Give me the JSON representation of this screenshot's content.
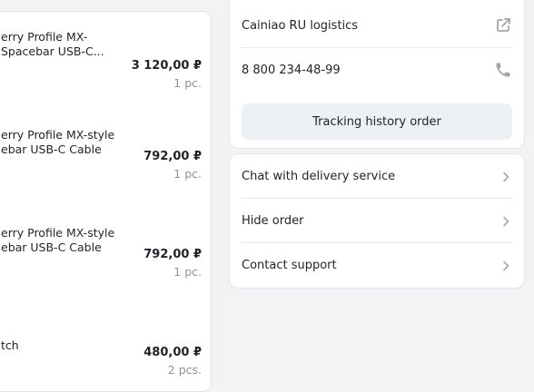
{
  "items": [
    {
      "title": "erry Profile MX-\nSpacebar USB-C...",
      "price": "3 120,00 ₽",
      "qty": "1 pc."
    },
    {
      "title": "erry Profile MX-style\nebar USB-C Cable",
      "price": "792,00 ₽",
      "qty": "1 pc."
    },
    {
      "title": "erry Profile MX-style\nebar USB-C Cable",
      "price": "792,00 ₽",
      "qty": "1 pc."
    },
    {
      "title": "tch",
      "price": "480,00 ₽",
      "qty": "2 pcs."
    }
  ],
  "delivery": {
    "carrier": "Cainiao RU logistics",
    "phone": "8 800 234-48-99",
    "tracking_button": "Tracking history order"
  },
  "actions": [
    {
      "label": "Chat with delivery service"
    },
    {
      "label": "Hide order"
    },
    {
      "label": "Contact support"
    }
  ],
  "icons": {
    "carrier_link": "external-link-icon",
    "phone": "phone-icon",
    "row_chevron": "chevron-right-icon"
  },
  "colors": {
    "page_bg": "#f2f3f5",
    "card_bg": "#ffffff",
    "button_bg": "#edf0f4",
    "muted_text": "#8c9199",
    "icon_gray": "#a1a5ab"
  }
}
